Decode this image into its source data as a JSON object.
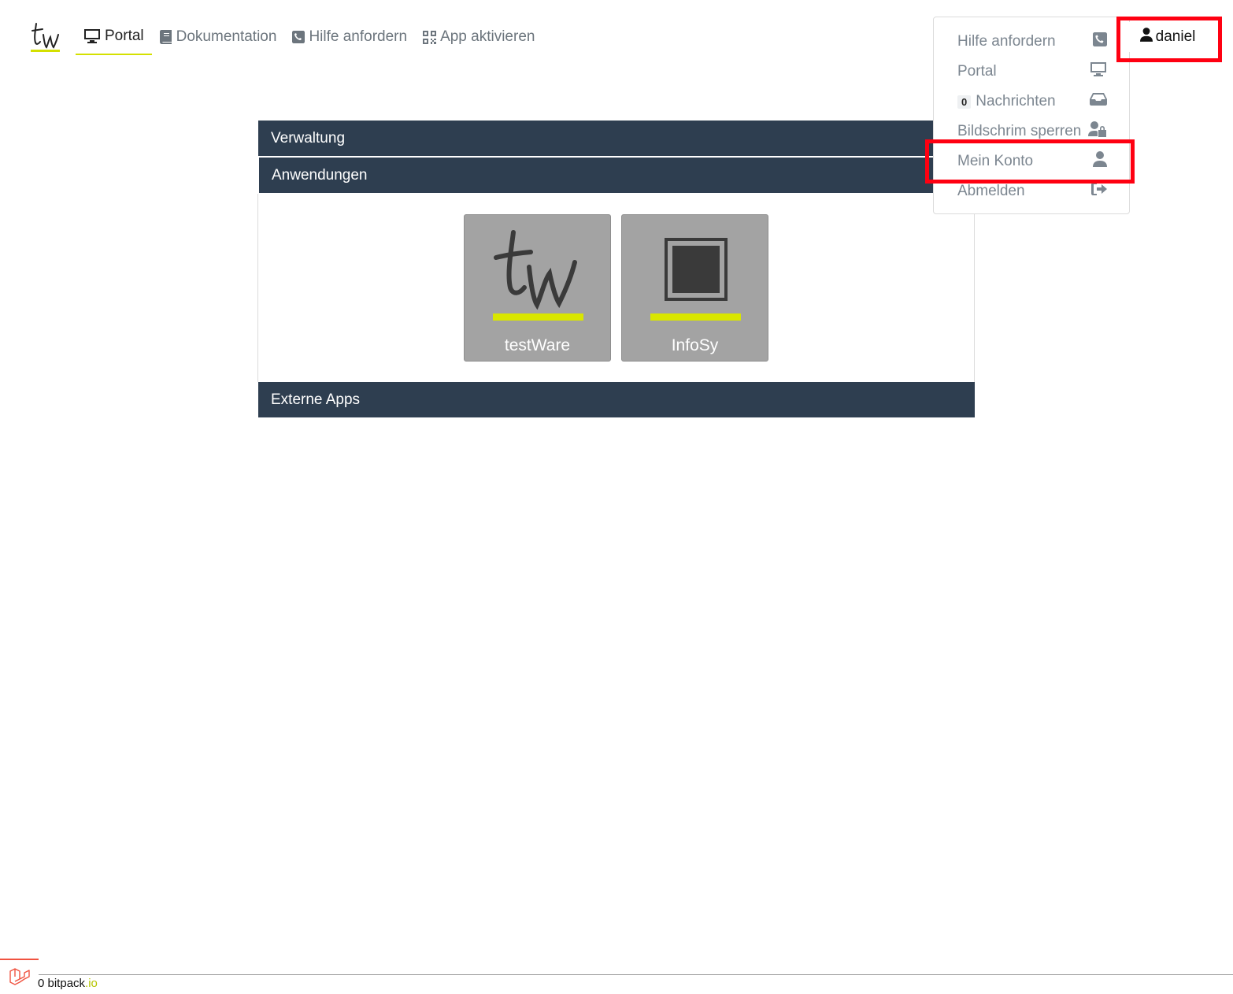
{
  "nav": {
    "items": [
      {
        "label": "Portal",
        "icon": "desktop-icon",
        "active": true
      },
      {
        "label": "Dokumentation",
        "icon": "book-icon"
      },
      {
        "label": "Hilfe anfordern",
        "icon": "phone-square-icon"
      },
      {
        "label": "App aktivieren",
        "icon": "qrcode-icon"
      }
    ]
  },
  "user": {
    "name": "daniel",
    "icon": "user-icon"
  },
  "dropdown": {
    "items": [
      {
        "label": "Hilfe anfordern",
        "icon": "phone-square-icon"
      },
      {
        "label": "Portal",
        "icon": "desktop-icon"
      },
      {
        "label": "Nachrichten",
        "badge": "0",
        "icon": "inbox-icon"
      },
      {
        "label": "Bildschrim sperren",
        "icon": "user-lock-icon"
      },
      {
        "label": "Mein Konto",
        "icon": "user-icon"
      },
      {
        "label": "Abmelden",
        "icon": "sign-out-icon"
      }
    ]
  },
  "sections": {
    "verwaltung": "Verwaltung",
    "anwendungen": "Anwendungen",
    "externe": "Externe Apps"
  },
  "apps": [
    {
      "label": "testWare",
      "icon": "testware-logo"
    },
    {
      "label": "InfoSy",
      "icon": "infosy-square-icon"
    }
  ],
  "footer": {
    "prefix": "0 bitpack",
    "suffix": ".io"
  },
  "colors": {
    "accent": "#d4e000",
    "header": "#2e3e50",
    "tile": "#a3a3a3",
    "highlight": "#ff0011"
  }
}
